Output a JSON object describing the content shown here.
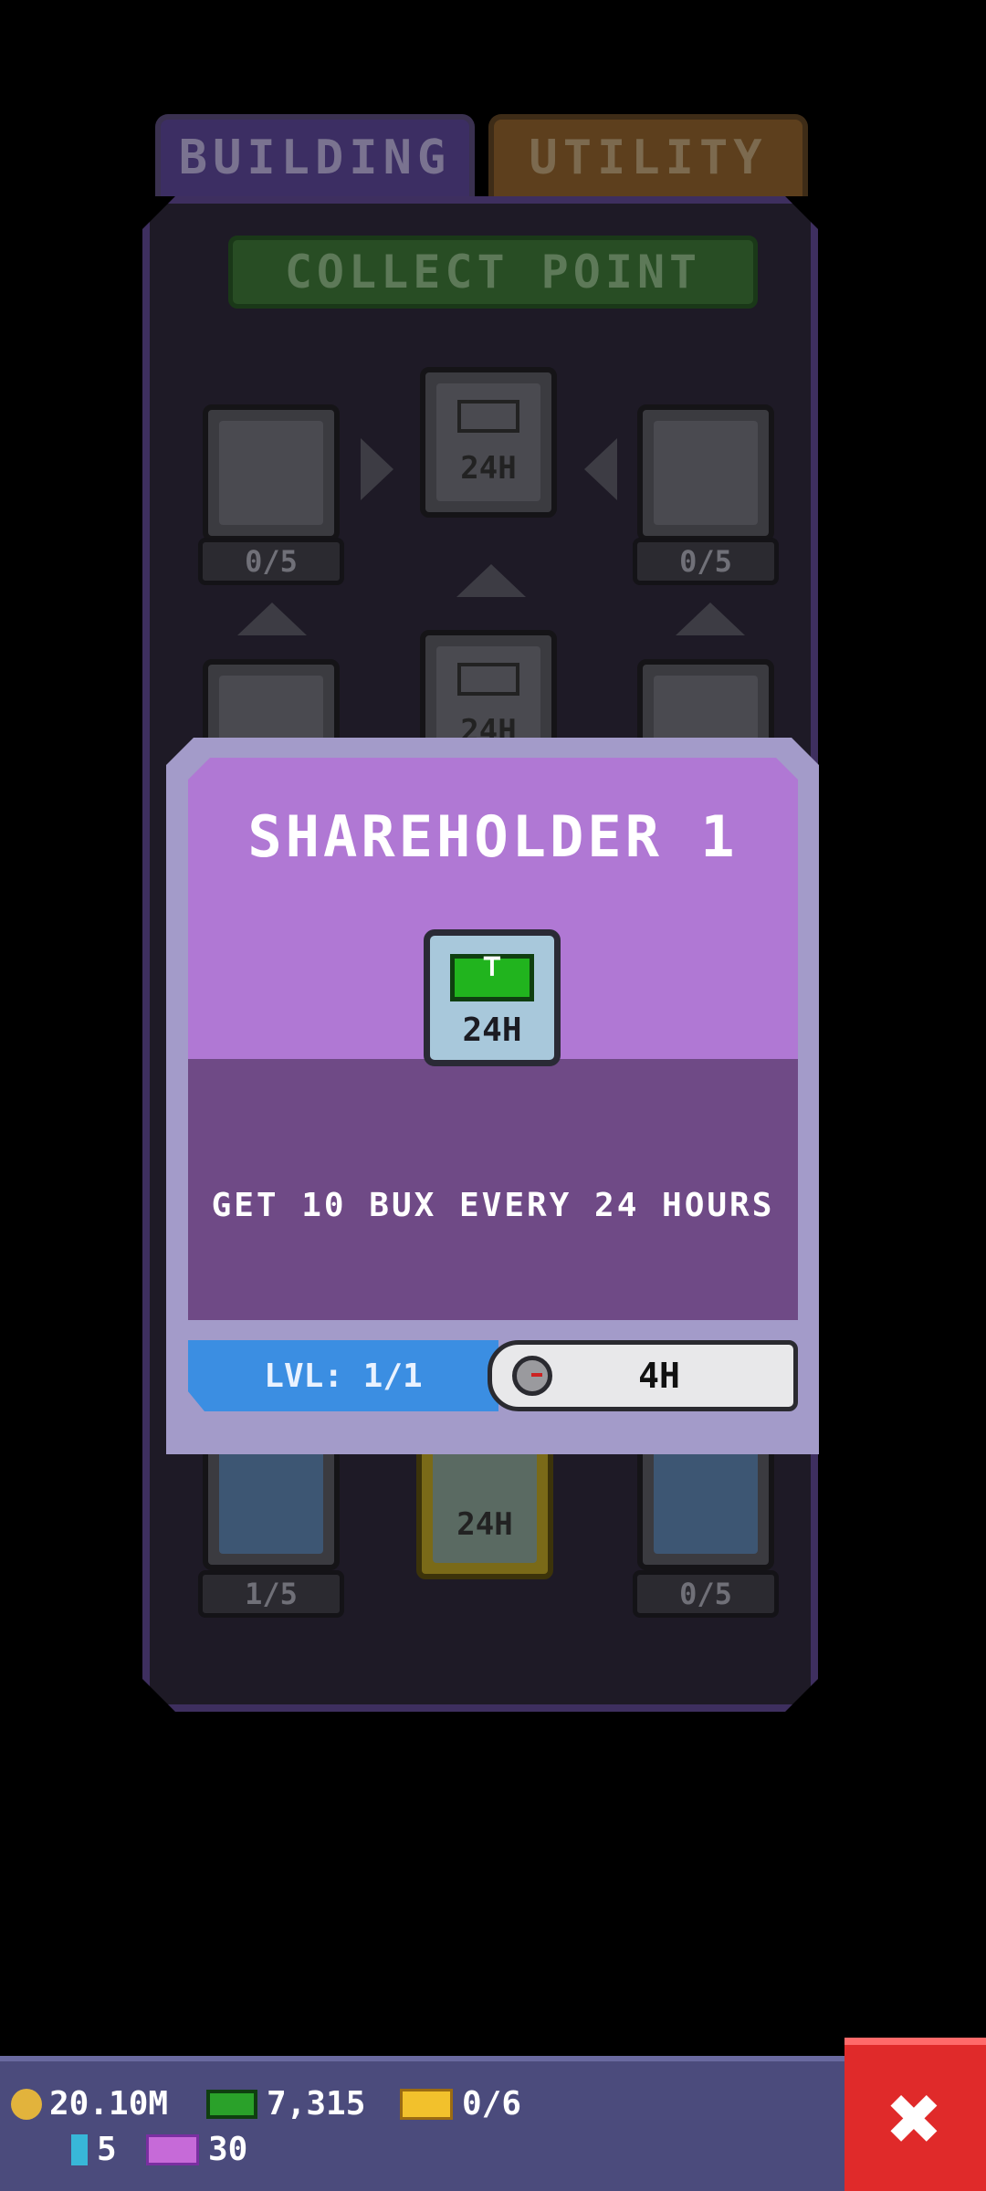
{
  "tabs": {
    "building": "BUILDING",
    "utility": "UTILITY"
  },
  "panel": {
    "section_title": "COLLECT POINT",
    "nodes": {
      "center_top_label": "24H",
      "left_top_count": "0/5",
      "right_top_count": "0/5",
      "center_mid_label": "24H",
      "left_bottom_count": "1/5",
      "center_bottom_label": "24H",
      "right_bottom_count": "0/5"
    }
  },
  "popup": {
    "title": "SHAREHOLDER 1",
    "icon_label": "24H",
    "icon_name": "cash-bill-icon",
    "description": "GET 10 BUX EVERY 24 HOURS",
    "level": "LVL: 1/1",
    "timer": "4H"
  },
  "resources": {
    "coins": "20.10M",
    "bux": "7,315",
    "tickets": "0/6",
    "gems": "5",
    "vip_tickets": "30"
  },
  "colors": {
    "panel_bg": "#1e1a26",
    "popup_top": "#b078d4",
    "popup_mid": "#6f4a86",
    "level_bar": "#3b8ee2",
    "close": "#e02a2a"
  }
}
